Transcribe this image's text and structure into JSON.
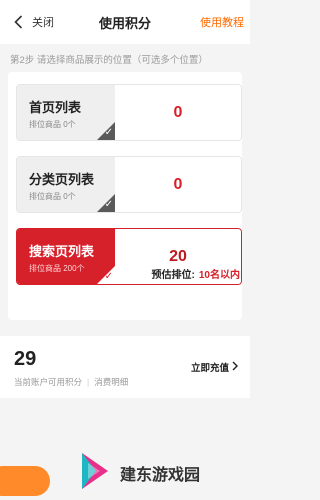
{
  "header": {
    "back_label": "关闭",
    "title": "使用积分",
    "tutorial_label": "使用教程"
  },
  "step_text": "第2步  请选择商品展示的位置（可选多个位置）",
  "options": [
    {
      "name": "首页列表",
      "sub": "排位商品 0个",
      "value": "0",
      "selected": false
    },
    {
      "name": "分类页列表",
      "sub": "排位商品 0个",
      "value": "0",
      "selected": false
    },
    {
      "name": "搜索页列表",
      "sub": "排位商品 200个",
      "value": "20",
      "selected": true
    }
  ],
  "estimate": {
    "label": "预估排位:",
    "value": "10名以内"
  },
  "points": {
    "value": "29",
    "desc": "当前账户可用积分",
    "separator": "|",
    "detail_link": "消费明细",
    "recharge_label": "立即充值"
  },
  "watermark": {
    "text": "建东游戏园"
  },
  "colors": {
    "accent_red": "#d6202a",
    "orange": "#ff6a00",
    "logo_pink": "#e8308a",
    "logo_teal": "#1fb6c4"
  },
  "icons": {
    "back": "close-chevron-left-icon",
    "check": "checkmark-icon",
    "recharge_arrow": "chevron-right-icon",
    "logo": "play-triangle-logo-icon"
  }
}
